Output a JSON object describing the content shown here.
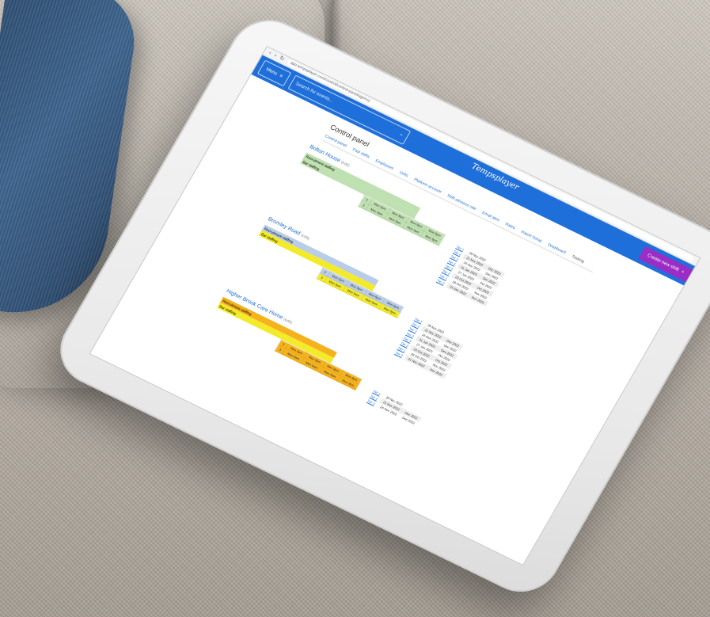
{
  "colors": {
    "header_blue": "#1e6fd9",
    "create_purple": "#9b2dc6",
    "green_fill": "#bfe0b0",
    "blue_fill": "#b9cde9",
    "yellow_fill": "#f3ea2a",
    "orange_fill": "#f6b21c"
  },
  "browser": {
    "url": "app.tempsplayer.com/control/control-panel/agency"
  },
  "header": {
    "menu_label": "Menu",
    "menu_icon": "hamburger-icon",
    "search_placeholder": "Search for events...",
    "search_icon": "search-icon",
    "logo": "Tempsplayer",
    "create_button": "Create new shift",
    "create_icon": "plus-icon"
  },
  "page": {
    "title": "Control panel"
  },
  "tabs": [
    {
      "label": "Control panel"
    },
    {
      "label": "Past shifts"
    },
    {
      "label": "Employees"
    },
    {
      "label": "Units"
    },
    {
      "label": "Platform account"
    },
    {
      "label": "Shift advance rate"
    },
    {
      "label": "Email alert"
    },
    {
      "label": "Rates"
    },
    {
      "label": "Import Setup"
    },
    {
      "label": "Dashboard"
    },
    {
      "label": "Tasking"
    }
  ],
  "sites": [
    {
      "name": "Bolton House",
      "sub": "(edit)",
      "theme": "green",
      "summary": [
        "Recruitment staffing",
        "Bar staffing"
      ],
      "shifts": [
        [
          "3",
          "Mon 6pm",
          "Mon 8pm",
          "Mon 8pm",
          "Mon 9pm"
        ],
        [
          "3",
          "Mon 9am",
          "Mon 9am",
          "Mon 9am",
          "Mon 9pm"
        ]
      ],
      "dates": [
        [
          "Tier 1",
          "28 Nov 2022",
          ""
        ],
        [
          "Tier 2",
          "21 Nov 2022",
          "Dec 2022"
        ],
        [
          "Tier 3",
          "26 Nov 2022",
          "Dec 2022"
        ],
        [
          "Tier 3",
          "31 Jan 2023",
          "Dec 2022"
        ],
        [
          "Tier 3",
          "27 Jan 2023",
          "Oct 2022"
        ],
        [
          "Tier 2",
          "23 Oct 2022",
          "Oct 2022"
        ],
        [
          "Tier 1",
          "28 Oct 2022",
          "Nov 2022"
        ],
        [
          "Tier 3",
          "21 Nov 2022",
          "Nov 2022"
        ]
      ]
    },
    {
      "name": "Bromley Road",
      "sub": "(edit)",
      "theme": "blue",
      "summary": [
        "Recruitment staffing",
        "Bar staffing"
      ],
      "shifts": [
        [
          "3",
          "Mon 6pm",
          "Mon 8pm",
          "Mon 8pm",
          "Mon 9pm"
        ],
        [
          "3",
          "Mon 9am",
          "Mon 9am",
          "Mon 9am",
          "Mon 9pm"
        ]
      ],
      "dates": [
        [
          "Tier 1",
          "28 Nov 2022",
          ""
        ],
        [
          "Tier 2",
          "21 Nov 2022",
          "Dec 2022"
        ],
        [
          "Tier 3",
          "26 Nov 2022",
          "Dec 2022"
        ],
        [
          "Tier 3",
          "31 Jan 2023",
          "Dec 2022"
        ],
        [
          "Tier 3",
          "27 Jan 2023",
          "Oct 2022"
        ],
        [
          "Tier 2",
          "23 Oct 2022",
          "Oct 2022"
        ],
        [
          "Tier 1",
          "28 Oct 2022",
          "Nov 2022"
        ],
        [
          "Tier 3",
          "21 Nov 2022",
          "Nov 2022"
        ]
      ]
    },
    {
      "name": "Higher Brook Care Home",
      "sub": "(edit)",
      "theme": "orange",
      "summary": [
        "Recruitment staffing",
        "Bar staffing"
      ],
      "shifts": [
        [
          "3",
          "Mon 6pm",
          "Mon 8pm",
          "Mon 8pm",
          "Mon 9pm"
        ],
        [
          "3",
          "Mon 9am",
          "Mon 9am",
          "Mon 9am",
          "Mon 9pm"
        ]
      ],
      "dates": [
        [
          "Tier 1",
          "28 Nov 2022",
          ""
        ],
        [
          "Tier 2",
          "21 Nov 2022",
          "Dec 2022"
        ],
        [
          "Tier 3",
          "26 Nov 2022",
          "Dec 2022"
        ]
      ]
    }
  ]
}
